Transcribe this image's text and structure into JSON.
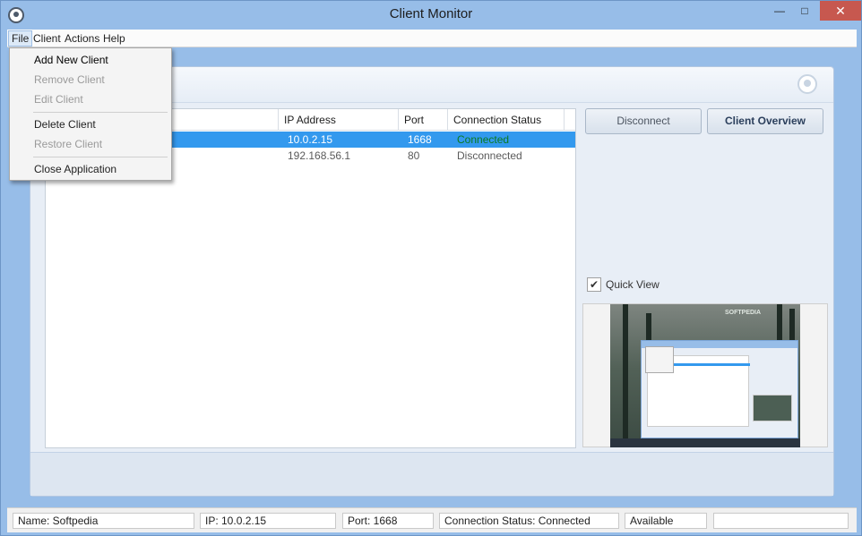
{
  "window": {
    "title": "Client Monitor"
  },
  "menubar": {
    "file": "File",
    "client": "Client",
    "actions": "Actions",
    "help": "Help"
  },
  "file_menu": {
    "add_new_client": "Add New Client",
    "remove_client": "Remove Client",
    "edit_client": "Edit Client",
    "delete_client": "Delete Client",
    "restore_client": "Restore Client",
    "close_application": "Close Application"
  },
  "table": {
    "columns": [
      "IP Address",
      "Port",
      "Connection Status"
    ],
    "rows": [
      {
        "ip": "10.0.2.15",
        "port": "1668",
        "status": "Connected",
        "selected": true
      },
      {
        "ip": "192.168.56.1",
        "port": "80",
        "status": "Disconnected",
        "selected": false
      }
    ]
  },
  "buttons": {
    "disconnect": "Disconnect",
    "client_overview": "Client Overview"
  },
  "quick_view": {
    "label": "Quick View",
    "checked": true
  },
  "status_bar": {
    "name": "Name: Softpedia",
    "ip": "IP: 10.0.2.15",
    "port": "Port: 1668",
    "connection_status": "Connection Status: Connected",
    "availability": "Available",
    "extra": ""
  },
  "preview": {
    "watermark": "SOFTPEDIA"
  },
  "colors": {
    "accent": "#3399ee",
    "connected": "#0b7a22",
    "close": "#c7584f",
    "frame": "#97bde8"
  }
}
